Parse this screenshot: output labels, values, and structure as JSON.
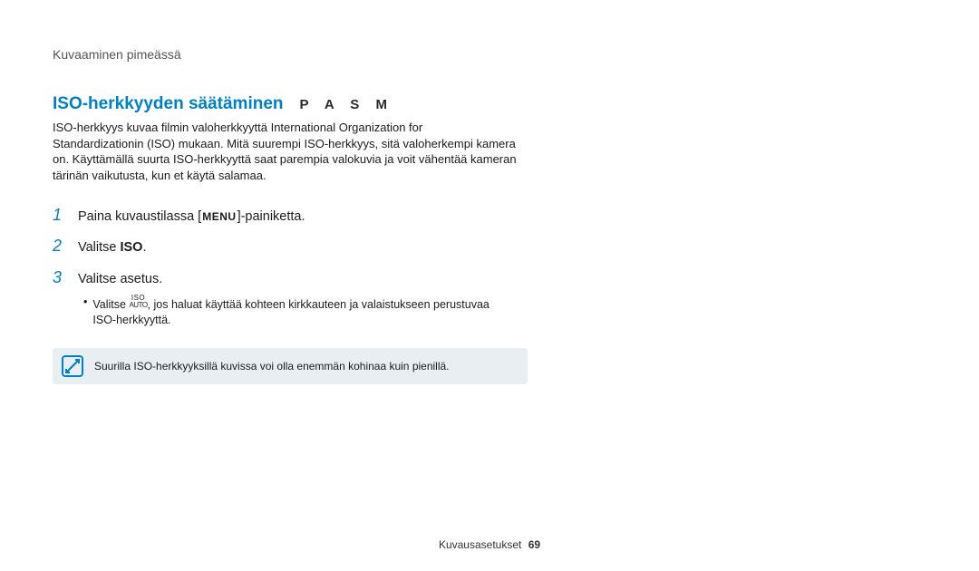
{
  "breadcrumb": "Kuvaaminen pimeässä",
  "heading": "ISO-herkkyyden säätäminen",
  "modes": "P A S M",
  "intro": "ISO-herkkyys kuvaa filmin valoherkkyyttä International Organization for Standardizationin (ISO) mukaan. Mitä suurempi ISO-herkkyys, sitä valoherkempi kamera on. Käyttämällä suurta ISO-herkkyyttä saat parempia valokuvia ja voit vähentää kameran tärinän vaikutusta, kun et käytä salamaa.",
  "steps": [
    {
      "num": "1",
      "pre": "Paina kuvaustilassa [",
      "mid": "MENU",
      "post": "]-painiketta."
    },
    {
      "num": "2",
      "pre": "Valitse ",
      "bold": "ISO",
      "post": "."
    },
    {
      "num": "3",
      "pre": "Valitse asetus.",
      "bold": "",
      "post": ""
    }
  ],
  "sub_bullet": {
    "pre": "Valitse ",
    "icon_top": "ISO",
    "icon_bot": "AUTO",
    "post": ", jos haluat käyttää kohteen kirkkauteen ja valaistukseen perustuvaa ISO-herkkyyttä."
  },
  "note": "Suurilla ISO-herkkyyksillä kuvissa voi olla enemmän kohinaa kuin pienillä.",
  "footer_label": "Kuvausasetukset",
  "footer_page": "69"
}
